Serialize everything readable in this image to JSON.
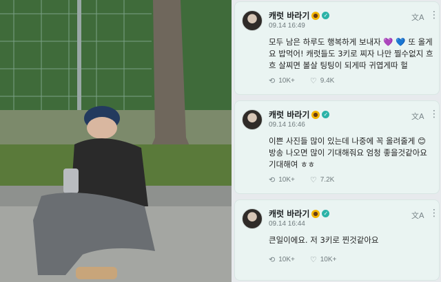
{
  "posts": [
    {
      "author": "캐럿 바라기",
      "time": "09.14 16:49",
      "text": "모두 남은 하루도 행복하게 보내자 💜 💙 또 올게요 밥먹어! 캐럿들도 3키로 찌자 나만 찔수없지 흐흐 살찌면 볼살 팅팅이 되게따 귀엽게따 헐",
      "comments": "10K+",
      "likes": "9.4K"
    },
    {
      "author": "캐럿 바라기",
      "time": "09.14 16:46",
      "text": "이쁜 사진들 많이 있는데 나중에 꼭 올려줄게 😊 방송 나오면 많이 기대해줘요 엄청 좋을것같아요 기대해여 ㅎㅎ",
      "comments": "10K+",
      "likes": "7.2K"
    },
    {
      "author": "캐럿 바라기",
      "time": "09.14 16:44",
      "text": "큰일이에요. 저 3키로 찐것같아요",
      "comments": "10K+",
      "likes": "10K+"
    }
  ],
  "icons": {
    "translate": "translate-icon",
    "more": "more-icon",
    "comment": "comment-icon",
    "like": "heart-icon",
    "verified": "verified-badge-icon"
  },
  "colors": {
    "card_bg": "#eaf4f2",
    "verified": "#2bb3a8",
    "text": "#222222",
    "meta": "#6f7a7d"
  }
}
